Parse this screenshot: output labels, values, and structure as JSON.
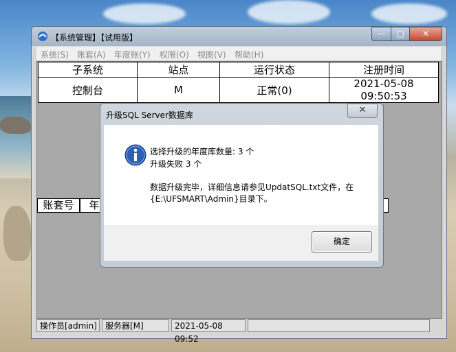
{
  "window": {
    "title": "【系统管理】【试用版】",
    "controls": {
      "minimize": "—",
      "maximize": "□",
      "close": "✕"
    }
  },
  "menu": [
    "系统(S)",
    "账套(A)",
    "年度账(Y)",
    "权限(O)",
    "视图(V)",
    "帮助(H)"
  ],
  "subsystem_table": {
    "headers": [
      "子系统",
      "站点",
      "运行状态",
      "注册时间"
    ],
    "rows": [
      [
        "控制台",
        "M",
        "正常(0)",
        "2021-05-08 09:50:53"
      ]
    ]
  },
  "account_table": {
    "headers": [
      "账套号",
      "年"
    ]
  },
  "statusbar": {
    "operator": "操作员[admin]",
    "server": "服务器[M]",
    "datetime": "2021-05-08 09:52"
  },
  "dialog": {
    "title": "升级SQL Server数据库",
    "close_glyph": "✕",
    "lines": [
      "选择升级的年度库数量: 3 个",
      "升级失败 3 个",
      "数据升级完毕，详细信息请参见UpdatSQL.txt文件，在",
      "{E:\\UFSMART\\Admin}目录下。"
    ],
    "ok_label": "确定"
  },
  "colors": {
    "info_icon": "#2f5fb5",
    "close_button": "#c34a32"
  }
}
